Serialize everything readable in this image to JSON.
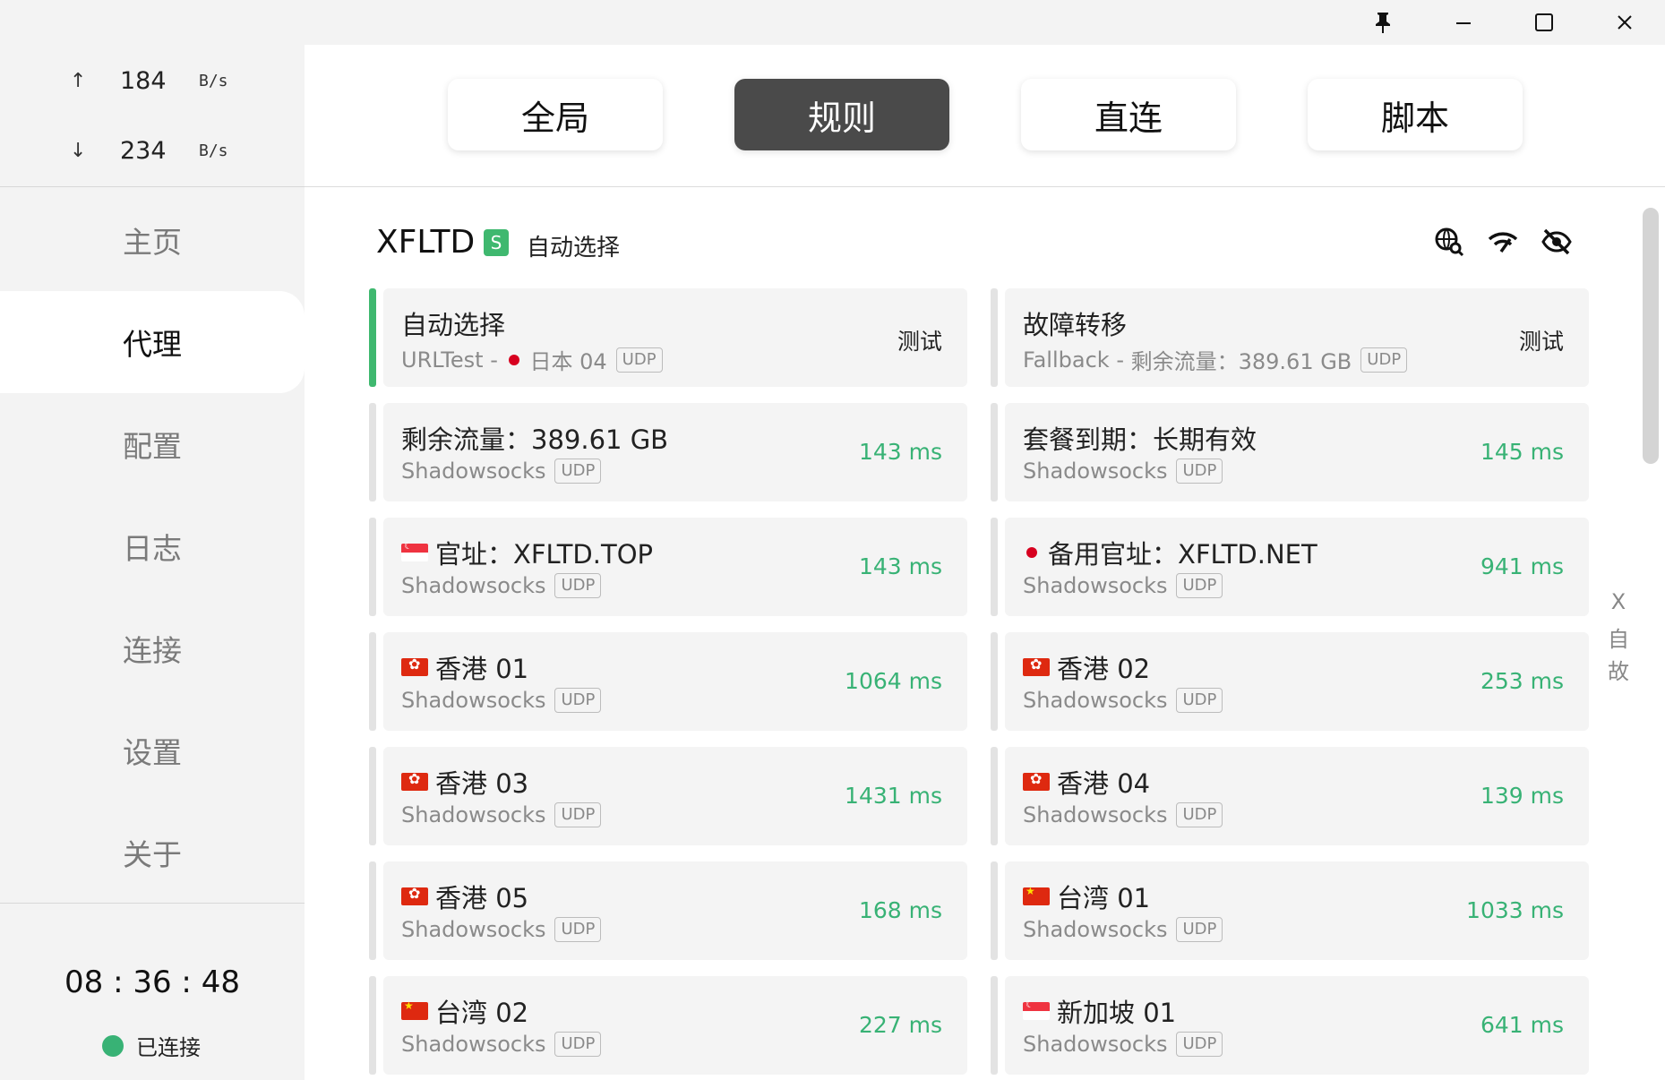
{
  "window": {
    "pin_icon": "pin-icon",
    "minimize_icon": "minimize-icon",
    "maximize_icon": "maximize-icon",
    "close_icon": "close-icon"
  },
  "traffic": {
    "up_arrow": "↑",
    "up_value": "184",
    "up_unit": "B/s",
    "down_arrow": "↓",
    "down_value": "234",
    "down_unit": "B/s"
  },
  "nav": {
    "items": [
      {
        "label": "主页"
      },
      {
        "label": "代理"
      },
      {
        "label": "配置"
      },
      {
        "label": "日志"
      },
      {
        "label": "连接"
      },
      {
        "label": "设置"
      },
      {
        "label": "关于"
      }
    ],
    "active": "代理"
  },
  "footer": {
    "clock": "08 : 36 : 48",
    "status": "已连接",
    "status_color": "#38b275"
  },
  "modes": {
    "items": [
      {
        "label": "全局"
      },
      {
        "label": "规则"
      },
      {
        "label": "直连"
      },
      {
        "label": "脚本"
      }
    ],
    "active": "规则"
  },
  "group": {
    "name": "XFLTD",
    "badge": "S",
    "now": "自动选择",
    "icons": [
      "network-search-icon",
      "wifi-speed-icon",
      "hide-icon"
    ]
  },
  "cards": [
    {
      "name": "自动选择",
      "sub_type": "URLTest",
      "sub_sep": " - ",
      "sub_flag": "jp",
      "sub_detail": "日本 04",
      "tag": "UDP",
      "right": "测试",
      "right_kind": "test",
      "selected": true
    },
    {
      "name": "故障转移",
      "sub_type": "Fallback",
      "sub_sep": " - ",
      "sub_flag": "",
      "sub_detail": "剩余流量：389.61 GB",
      "tag": "UDP",
      "right": "测试",
      "right_kind": "test",
      "selected": false
    },
    {
      "name": "剩余流量：389.61 GB",
      "flag": "",
      "sub_type": "Shadowsocks",
      "tag": "UDP",
      "right": "143 ms",
      "right_kind": "delay"
    },
    {
      "name": "套餐到期：长期有效",
      "flag": "",
      "sub_type": "Shadowsocks",
      "tag": "UDP",
      "right": "145 ms",
      "right_kind": "delay"
    },
    {
      "name": "官址：XFLTD.TOP",
      "flag": "sg",
      "sub_type": "Shadowsocks",
      "tag": "UDP",
      "right": "143 ms",
      "right_kind": "delay"
    },
    {
      "name": "备用官址：XFLTD.NET",
      "flag": "jp",
      "sub_type": "Shadowsocks",
      "tag": "UDP",
      "right": "941 ms",
      "right_kind": "delay"
    },
    {
      "name": "香港 01",
      "flag": "hk",
      "sub_type": "Shadowsocks",
      "tag": "UDP",
      "right": "1064 ms",
      "right_kind": "delay"
    },
    {
      "name": "香港 02",
      "flag": "hk",
      "sub_type": "Shadowsocks",
      "tag": "UDP",
      "right": "253 ms",
      "right_kind": "delay"
    },
    {
      "name": "香港 03",
      "flag": "hk",
      "sub_type": "Shadowsocks",
      "tag": "UDP",
      "right": "1431 ms",
      "right_kind": "delay"
    },
    {
      "name": "香港 04",
      "flag": "hk",
      "sub_type": "Shadowsocks",
      "tag": "UDP",
      "right": "139 ms",
      "right_kind": "delay"
    },
    {
      "name": "香港 05",
      "flag": "hk",
      "sub_type": "Shadowsocks",
      "tag": "UDP",
      "right": "168 ms",
      "right_kind": "delay"
    },
    {
      "name": "台湾 01",
      "flag": "cn",
      "sub_type": "Shadowsocks",
      "tag": "UDP",
      "right": "1033 ms",
      "right_kind": "delay"
    },
    {
      "name": "台湾 02",
      "flag": "cn",
      "sub_type": "Shadowsocks",
      "tag": "UDP",
      "right": "227 ms",
      "right_kind": "delay"
    },
    {
      "name": "新加坡 01",
      "flag": "sg",
      "sub_type": "Shadowsocks",
      "tag": "UDP",
      "right": "641 ms",
      "right_kind": "delay"
    }
  ],
  "side_index": [
    "X",
    "自",
    "故"
  ],
  "colors": {
    "accent_green": "#38b275",
    "active_mode_bg": "#4a4a4a",
    "card_bg": "#f4f4f4",
    "sidebar_bg": "#f3f3f3"
  }
}
